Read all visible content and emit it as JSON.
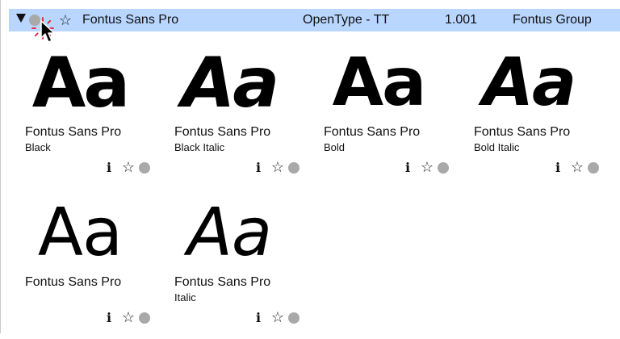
{
  "header": {
    "family_name": "Fontus Sans Pro",
    "format": "OpenType - TT",
    "version": "1.001",
    "foundry": "Fontus Group",
    "expand_icon": "disclosure-triangle-down",
    "activation_icon": "gray-circle",
    "favorite_icon": "star-outline"
  },
  "fonts": [
    {
      "sample": "Aa",
      "name": "Fontus Sans Pro",
      "style": "Black",
      "weight": "black",
      "italic": false
    },
    {
      "sample": "Aa",
      "name": "Fontus Sans Pro",
      "style": "Black Italic",
      "weight": "black",
      "italic": true
    },
    {
      "sample": "Aa",
      "name": "Fontus Sans Pro",
      "style": "Bold",
      "weight": "bold",
      "italic": false
    },
    {
      "sample": "Aa",
      "name": "Fontus Sans Pro",
      "style": "Bold Italic",
      "weight": "bold",
      "italic": true
    },
    {
      "sample": "Aa",
      "name": "Fontus Sans Pro",
      "style": "",
      "weight": "regular",
      "italic": false
    },
    {
      "sample": "Aa",
      "name": "Fontus Sans Pro",
      "style": "Italic",
      "weight": "regular",
      "italic": true
    }
  ],
  "card_controls": {
    "info_label": "i",
    "star_label": "☆",
    "info_icon": "info-icon",
    "favorite_icon": "star-outline",
    "status_icon": "gray-circle"
  },
  "colors": {
    "header_bg": "#b8d6ff",
    "inactive_dot": "#a9a9a9",
    "cursor_sparkle": "#e8192c"
  }
}
